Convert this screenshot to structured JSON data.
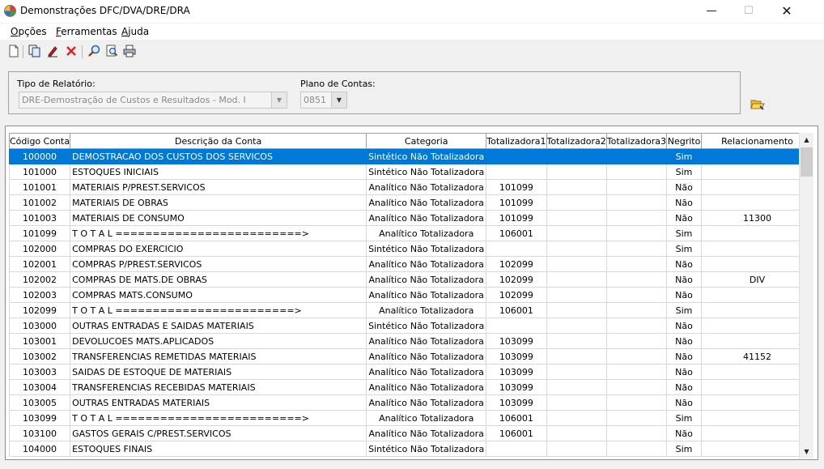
{
  "window": {
    "title": "Demonstrações DFC/DVA/DRE/DRA",
    "minimize": "—",
    "maximize": "☐",
    "close": "✕"
  },
  "menu": [
    {
      "prefix": "",
      "ul": "O",
      "rest": "pções"
    },
    {
      "prefix": "",
      "ul": "F",
      "rest": "erramentas"
    },
    {
      "prefix": "",
      "ul": "A",
      "rest": "juda"
    }
  ],
  "toolbar_icons": [
    "new-document-icon",
    "copy-icon",
    "edit-icon",
    "delete-icon",
    "search-icon",
    "find-icon",
    "print-icon"
  ],
  "filters": {
    "tipo_label": "Tipo de Relatório:",
    "tipo_value": "DRE-Demostração de Custos e Resultados - Mod. I",
    "plano_label": "Plano de Contas:",
    "plano_value": "0851"
  },
  "grid": {
    "columns": [
      "Código Conta",
      "Descrição da Conta",
      "Categoria",
      "Totalizadora1",
      "Totalizadora2",
      "Totalizadora3",
      "Negrito",
      "Relacionamento"
    ],
    "rows": [
      [
        "100000",
        "DEMOSTRACAO DOS CUSTOS DOS SERVICOS",
        "Sintético Não Totalizadora",
        "",
        "",
        "",
        "Sim",
        ""
      ],
      [
        "101000",
        "ESTOQUES INICIAIS",
        "Sintético Não Totalizadora",
        "",
        "",
        "",
        "Sim",
        ""
      ],
      [
        "101001",
        "MATERIAIS P/PREST.SERVICOS",
        "Analítico Não Totalizadora",
        "101099",
        "",
        "",
        "Não",
        ""
      ],
      [
        "101002",
        "MATERIAIS DE OBRAS",
        "Analítico Não Totalizadora",
        "101099",
        "",
        "",
        "Não",
        ""
      ],
      [
        "101003",
        "MATERIAIS DE CONSUMO",
        "Analítico Não Totalizadora",
        "101099",
        "",
        "",
        "Não",
        "11300"
      ],
      [
        "101099",
        "T O T A L =========================>",
        "Analítico Totalizadora",
        "106001",
        "",
        "",
        "Sim",
        ""
      ],
      [
        "102000",
        "COMPRAS DO EXERCICIO",
        "Sintético Não Totalizadora",
        "",
        "",
        "",
        "Sim",
        ""
      ],
      [
        "102001",
        "COMPRAS P/PREST.SERVICOS",
        "Analítico Não Totalizadora",
        "102099",
        "",
        "",
        "Não",
        ""
      ],
      [
        "102002",
        "COMPRAS DE MATS.DE OBRAS",
        "Analítico Não Totalizadora",
        "102099",
        "",
        "",
        "Não",
        "DIV"
      ],
      [
        "102003",
        "COMPRAS MATS.CONSUMO",
        "Analítico Não Totalizadora",
        "102099",
        "",
        "",
        "Não",
        ""
      ],
      [
        "102099",
        "T O T A L ========================>",
        "Analítico Totalizadora",
        "106001",
        "",
        "",
        "Sim",
        ""
      ],
      [
        "103000",
        "OUTRAS ENTRADAS E SAIDAS MATERIAIS",
        "Sintético Não Totalizadora",
        "",
        "",
        "",
        "Não",
        ""
      ],
      [
        "103001",
        "DEVOLUCOES MATS.APLICADOS",
        "Analítico Não Totalizadora",
        "103099",
        "",
        "",
        "Não",
        ""
      ],
      [
        "103002",
        "TRANSFERENCIAS REMETIDAS MATERIAIS",
        "Analítico Não Totalizadora",
        "103099",
        "",
        "",
        "Não",
        "41152"
      ],
      [
        "103003",
        "SAIDAS DE ESTOQUE DE MATERIAIS",
        "Analítico Não Totalizadora",
        "103099",
        "",
        "",
        "Não",
        ""
      ],
      [
        "103004",
        "TRANSFERENCIAS RECEBIDAS MATERIAIS",
        "Analítico Não Totalizadora",
        "103099",
        "",
        "",
        "Não",
        ""
      ],
      [
        "103005",
        "OUTRAS ENTRADAS MATERIAIS",
        "Analítico Não Totalizadora",
        "103099",
        "",
        "",
        "Não",
        ""
      ],
      [
        "103099",
        "T O T A L =========================>",
        "Analítico Totalizadora",
        "106001",
        "",
        "",
        "Sim",
        ""
      ],
      [
        "103100",
        "GASTOS GERAIS C/PREST.SERVICOS",
        "Analítico Não Totalizadora",
        "106001",
        "",
        "",
        "Não",
        ""
      ],
      [
        "104000",
        "ESTOQUES FINAIS",
        "Sintético Não Totalizadora",
        "",
        "",
        "",
        "Sim",
        ""
      ]
    ],
    "selected_row": 0
  },
  "scrollbar": {
    "up": "▲",
    "down": "▼"
  },
  "colors": {
    "selection": "#0078d7"
  }
}
